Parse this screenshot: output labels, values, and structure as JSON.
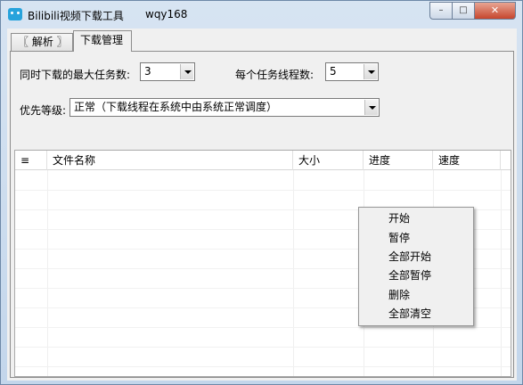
{
  "window": {
    "title": "Bilibili视频下载工具",
    "user": "wqy168",
    "buttons": {
      "minimize": "–",
      "maximize": "□",
      "close": "✕"
    }
  },
  "tabs": [
    {
      "label": "〖 解析 〗",
      "active": false
    },
    {
      "label": "下载管理",
      "active": true
    }
  ],
  "settings": {
    "max_tasks_label": "同时下载的最大任务数:",
    "max_tasks_value": "3",
    "threads_label": "每个任务线程数:",
    "threads_value": "5",
    "priority_label": "优先等级:",
    "priority_value": "正常（下载线程在系统中由系统正常调度）"
  },
  "table": {
    "columns": [
      "≡",
      "文件名称",
      "大小",
      "进度",
      "速度"
    ],
    "rows": []
  },
  "context_menu": {
    "items": [
      "开始",
      "暂停",
      "全部开始",
      "全部暂停",
      "删除",
      "全部清空"
    ]
  },
  "colors": {
    "titlebar": "#cfdeef",
    "close_button": "#c6462d",
    "client_bg": "#f0f0f0"
  }
}
